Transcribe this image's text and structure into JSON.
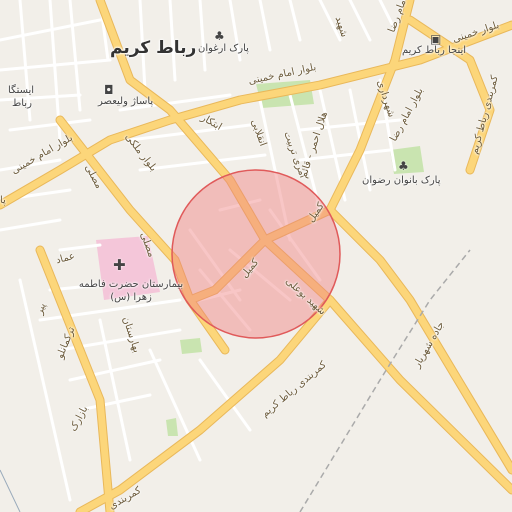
{
  "map": {
    "city_label": "رباط کریم",
    "icons": {
      "hospital": "hospital-cross-icon",
      "park": "tree-icon",
      "shop": "shopping-bag-icon",
      "bus": "bus-icon"
    },
    "colors": {
      "background": "#f2efe9",
      "major_road": "#fcd67a",
      "major_road_outline": "#e9b85a",
      "minor_road": "#ffffff",
      "minor_road_outline": "#d9d4cc",
      "park": "#c9e4b0",
      "hospital_area": "#f4c6d9",
      "radius_fill": "#f08080",
      "radius_stroke": "#e05a5a"
    },
    "pois": {
      "park_arghavan": "پارک ارغوان",
      "bus_station": "اینجا رباط کریم",
      "bazaar": "پاساژ ولیعصر",
      "park_banoan": "پارک بانوان رضوان",
      "hospital": "بیمارستان حضرت فاطمه زهرا (س)",
      "station_edge": "ایستگا",
      "station_edge2": "رباط"
    },
    "streets": {
      "blvd_khomeini_top": "بلوار امام خمینی",
      "blvd_khomeini_left": "بلوار امام خمینی",
      "blvd_khomeini_right": "بلوار خمینی",
      "blvd_mosalla": "بلوار ملکی",
      "blvd_imam_reza": "بلوار امام رضا",
      "ebtekar": "ابتکار",
      "enghelabi": "انقلابی",
      "tavana": "امری تربیت",
      "helal_ahmar": "هلال احمر - قائم",
      "shahrdari": "شهرداری",
      "shahid": "شهید",
      "imam_reza": "امام رضا",
      "kamil": "کمیل",
      "kamil2": "کمیل",
      "shahid_bouleyi": "شهید بوعلی",
      "kamarbandi": "کمربندی رباط کریم",
      "kamarbandi_right": "کمربندی رباط کریم",
      "kamarbandi_bottom": "کمربندی",
      "jadeh": "جاده شهریار",
      "baharestan": "بهارستان",
      "torkmanlu": "ترکمانلو",
      "bazarak": "بازارک",
      "mosalla": "مصلی",
      "mosalla2": "مصلی",
      "emad": "عماد",
      "pir": "پیر",
      "pa": "پا"
    }
  }
}
